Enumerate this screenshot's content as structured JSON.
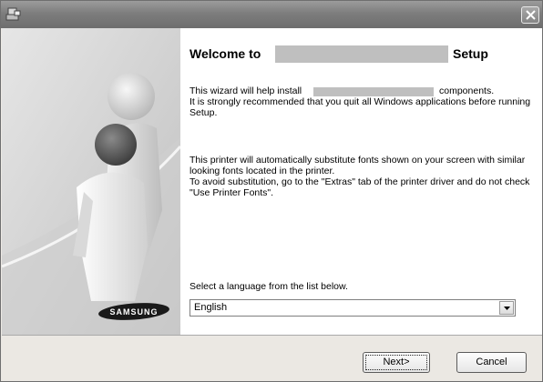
{
  "window": {
    "title": "",
    "app_icon": "setup-icon",
    "close_icon": "close-icon"
  },
  "sidebar": {
    "brand": "SAMSUNG",
    "illustration": "people-illustration"
  },
  "content": {
    "heading_prefix": "Welcome to",
    "heading_suffix": "Setup",
    "p1_start": "This wizard will help install",
    "p1_end": "components.",
    "p1_rest": "It is strongly recommended that you quit all Windows applications before running Setup.",
    "p2": "This printer will automatically substitute fonts shown on your screen with similar looking fonts located in the printer.\nTo avoid substitution, go to the \"Extras\" tab of the printer driver and do not check \"Use Printer Fonts\".",
    "language_label": "Select a language from the list below.",
    "language_value": "English",
    "dots": "...................."
  },
  "footer": {
    "next_label": "Next>",
    "cancel_label": "Cancel"
  },
  "colors": {
    "titlebar": "#7d7d7d",
    "panel": "#d6d6d6",
    "dialog": "#ebe8e3",
    "redaction": "#bfbfbf"
  }
}
